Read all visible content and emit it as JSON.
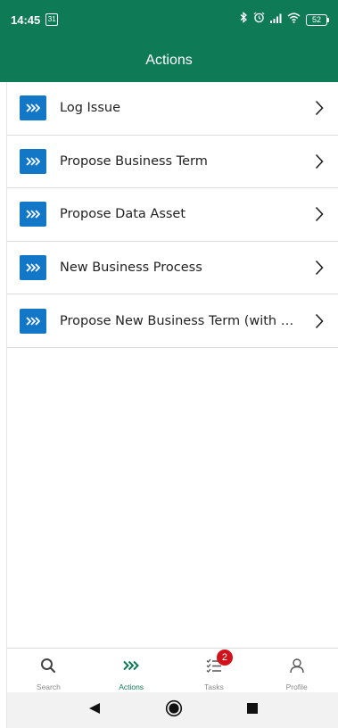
{
  "status_bar": {
    "time": "14:45",
    "calendar_day": "31",
    "battery": "52",
    "icons": [
      "calendar-icon",
      "bluetooth-icon",
      "alarm-icon",
      "signal-icon",
      "wifi-icon",
      "battery-icon"
    ]
  },
  "app_bar": {
    "title": "Actions"
  },
  "colors": {
    "brand_green": "#0e7a56",
    "action_blue": "#1377c8",
    "badge_red": "#d0121b"
  },
  "actions": [
    {
      "label": "Log Issue",
      "icon": "chevrons-right-icon"
    },
    {
      "label": "Propose Business Term",
      "icon": "chevrons-right-icon"
    },
    {
      "label": "Propose Data Asset",
      "icon": "chevrons-right-icon"
    },
    {
      "label": "New Business Process",
      "icon": "chevrons-right-icon"
    },
    {
      "label": "Propose New Business Term (with Duplic...",
      "icon": "chevrons-right-icon"
    }
  ],
  "bottom_nav": {
    "items": [
      {
        "label": "Search",
        "icon": "search-icon",
        "active": false
      },
      {
        "label": "Actions",
        "icon": "chevrons-right-icon",
        "active": true
      },
      {
        "label": "Tasks",
        "icon": "tasks-icon",
        "active": false,
        "badge": "2"
      },
      {
        "label": "Profile",
        "icon": "profile-icon",
        "active": false
      }
    ]
  },
  "system_nav": [
    "back-icon",
    "home-icon",
    "recents-icon"
  ]
}
